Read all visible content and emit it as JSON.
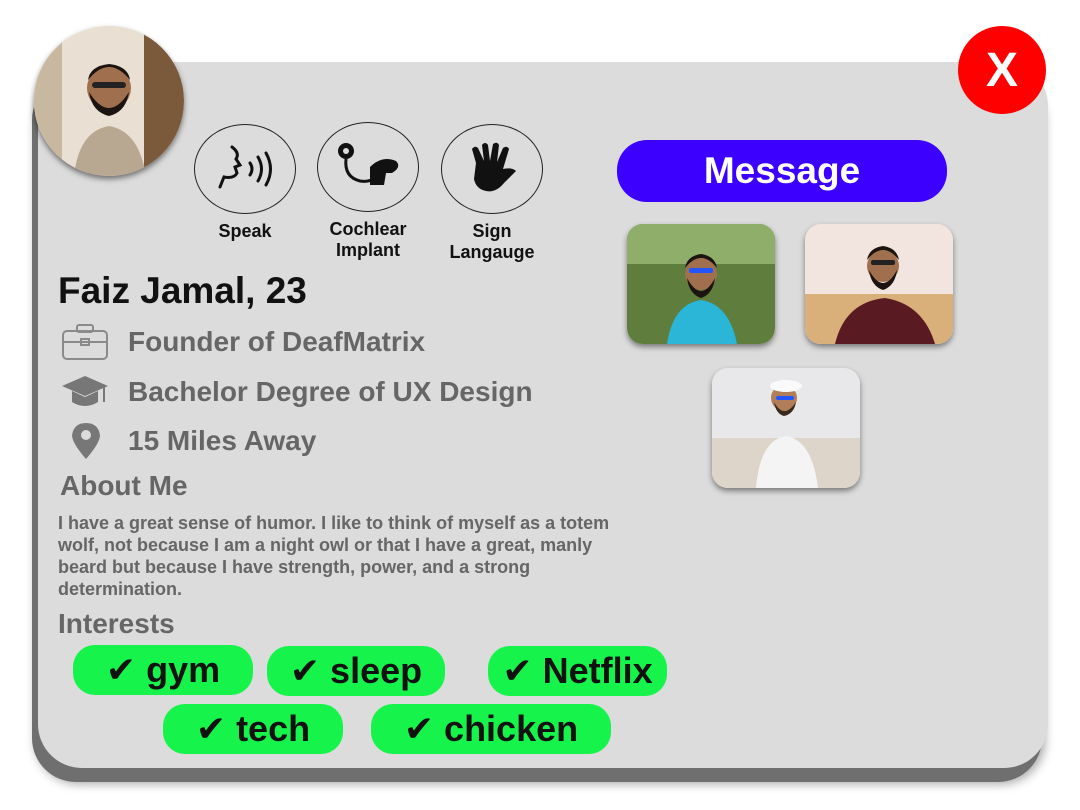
{
  "profile": {
    "name_age": "Faiz Jamal, 23",
    "job": "Founder of DeafMatrix",
    "education": "Bachelor Degree of UX Design",
    "distance": "15 Miles Away"
  },
  "close_label": "X",
  "abilities": [
    {
      "label": "Speak",
      "icon": "speaking-head-icon"
    },
    {
      "label": "Cochlear Implant",
      "icon": "cochlear-implant-icon"
    },
    {
      "label": "Sign Langauge",
      "icon": "sign-language-hand-icon"
    }
  ],
  "about": {
    "title": "About Me",
    "text": "I have a great sense of humor. I like to think of myself as a totem wolf, not because I am a night owl or that I have a great, manly beard but because I have strength, power, and a strong determination."
  },
  "interests": {
    "title": "Interests",
    "items": [
      "✔ gym",
      "✔ sleep",
      "✔ Netflix",
      "✔ tech",
      "✔ chicken"
    ]
  },
  "actions": {
    "message_label": "Message"
  },
  "colors": {
    "card": "#dcdcdc",
    "close": "#ff0000",
    "message": "#3b00ff",
    "chip": "#16f34a",
    "muted_text": "#666666"
  },
  "icons": {
    "job": "briefcase-icon",
    "education": "graduation-cap-icon",
    "location": "location-pin-icon"
  }
}
